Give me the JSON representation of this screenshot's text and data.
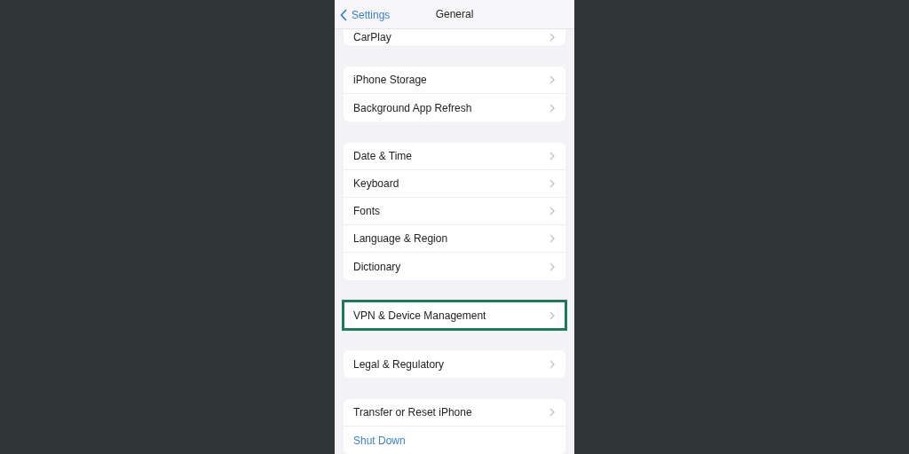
{
  "nav": {
    "back_label": "Settings",
    "title": "General"
  },
  "groups": [
    {
      "rows": [
        {
          "label": "CarPlay",
          "kind": "link",
          "highlighted": false
        }
      ]
    },
    {
      "rows": [
        {
          "label": "iPhone Storage",
          "kind": "link",
          "highlighted": false
        },
        {
          "label": "Background App Refresh",
          "kind": "link",
          "highlighted": false
        }
      ]
    },
    {
      "rows": [
        {
          "label": "Date & Time",
          "kind": "link",
          "highlighted": false
        },
        {
          "label": "Keyboard",
          "kind": "link",
          "highlighted": false
        },
        {
          "label": "Fonts",
          "kind": "link",
          "highlighted": false
        },
        {
          "label": "Language & Region",
          "kind": "link",
          "highlighted": false
        },
        {
          "label": "Dictionary",
          "kind": "link",
          "highlighted": false
        }
      ]
    },
    {
      "rows": [
        {
          "label": "VPN & Device Management",
          "kind": "link",
          "highlighted": true
        }
      ]
    },
    {
      "rows": [
        {
          "label": "Legal & Regulatory",
          "kind": "link",
          "highlighted": false
        }
      ]
    },
    {
      "rows": [
        {
          "label": "Transfer or Reset iPhone",
          "kind": "link",
          "highlighted": false
        },
        {
          "label": "Shut Down",
          "kind": "action",
          "highlighted": false
        }
      ]
    }
  ]
}
